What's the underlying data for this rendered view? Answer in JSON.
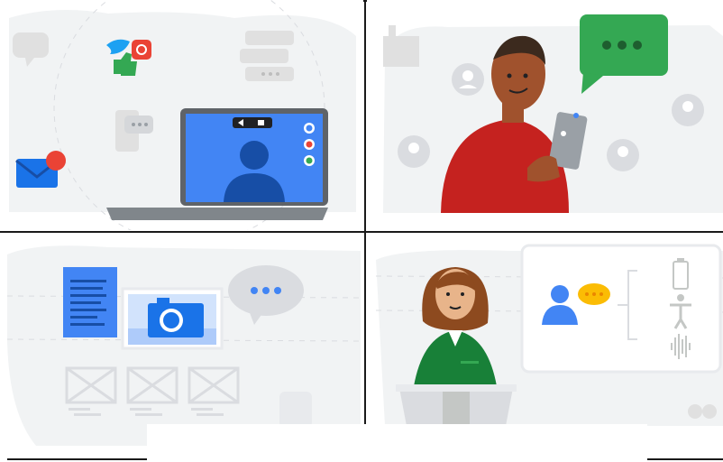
{
  "panels": [
    {
      "scene": "remote-meeting",
      "icons": [
        "twitter-icon",
        "instagram-icon",
        "thumbs-up-icon",
        "mail-icon",
        "chat-bubbles-icon",
        "phone-chat-icon",
        "laptop-video-call"
      ]
    },
    {
      "scene": "person-with-tablet",
      "icons": [
        "chat-bubble-icon",
        "user-avatar-icon",
        "tablet-icon"
      ]
    },
    {
      "scene": "content-creation",
      "icons": [
        "document-icon",
        "camera-icon",
        "chat-bubble-icon",
        "image-placeholder-icon"
      ]
    },
    {
      "scene": "presenter-at-podium",
      "icons": [
        "person-chat-icon",
        "battery-icon",
        "accessibility-icon",
        "audio-wave-icon"
      ]
    }
  ],
  "colors": {
    "blue": "#4285f4",
    "red": "#ea4335",
    "green": "#34a853",
    "yellow": "#fbbc04",
    "gray_bg": "#f1f3f4"
  }
}
